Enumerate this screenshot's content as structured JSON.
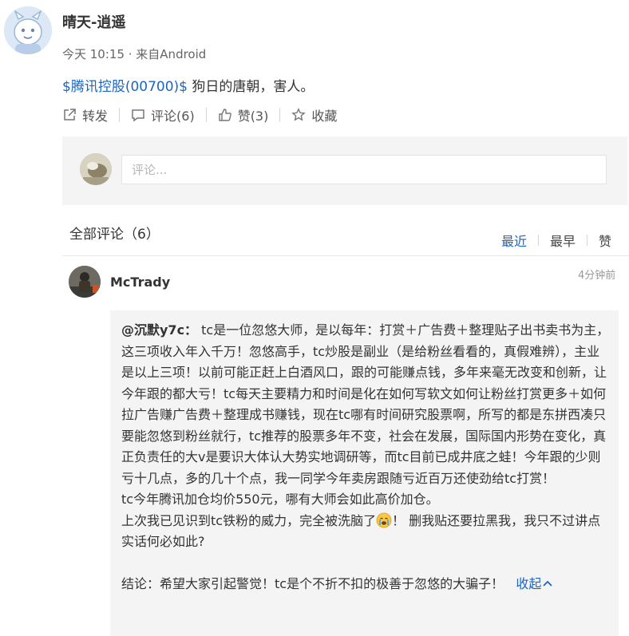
{
  "post": {
    "author": "晴天-逍遥",
    "meta": "今天 10:15 · 来自Android",
    "stock_link": "$腾讯控股(00700)$",
    "text": " 狗日的唐朝，害人。",
    "actions": {
      "repost": "转发",
      "comment": "评论(6)",
      "like": "赞(3)",
      "favorite": "收藏"
    }
  },
  "comment_box": {
    "placeholder": "评论..."
  },
  "comments": {
    "header": "全部评论（6）",
    "sort": [
      "最近",
      "最早",
      "赞"
    ],
    "items": [
      {
        "author": "McTrady",
        "time": "4分钟前",
        "mention": "@沉默y7c：",
        "para1": " tc是一位忽悠大师，是以每年：打赏＋广告费＋整理贴子出书卖书为主，这三项收入年入千万！忽悠高手，tc炒股是副业（是给粉丝看看的，真假难辨），主业是以上三项！以前可能正赶上白酒风口，跟的可能赚点钱，多年来毫无改变和创新，让今年跟的都大亏！tc每天主要精力和时间是化在如何写软文如何让粉丝打赏更多＋如何拉广告赚广告费＋整理成书赚钱，现在tc哪有时间研究股票啊，所写的都是东拼西凑只要能忽悠到粉丝就行，tc推荐的股票多年不变，社会在发展，国际国内形势在变化，真正负责任的大v是要识大体认大势实地调研等，而tc目前已成井底之蛙！今年跟的少则亏十几点，多的几十个点，我一同学今年卖房跟随亏近百万还使劲给tc打赏！",
        "para2": "tc今年腾讯加仓均价550元，哪有大师会如此高价加仓。",
        "para3a": "上次我已见识到tc铁粉的威力，完全被洗脑了",
        "emoji": "crying-face",
        "para3b": "！ 删我贴还要拉黑我，我只不过讲点实话何必如此?",
        "conclusion": "结论：希望大家引起警觉！tc是个不折不扣的极善于忽悠的大骗子！",
        "collapse": "收起"
      }
    ]
  },
  "colors": {
    "link": "#1a66c4",
    "panel": "#f4f4f4"
  }
}
